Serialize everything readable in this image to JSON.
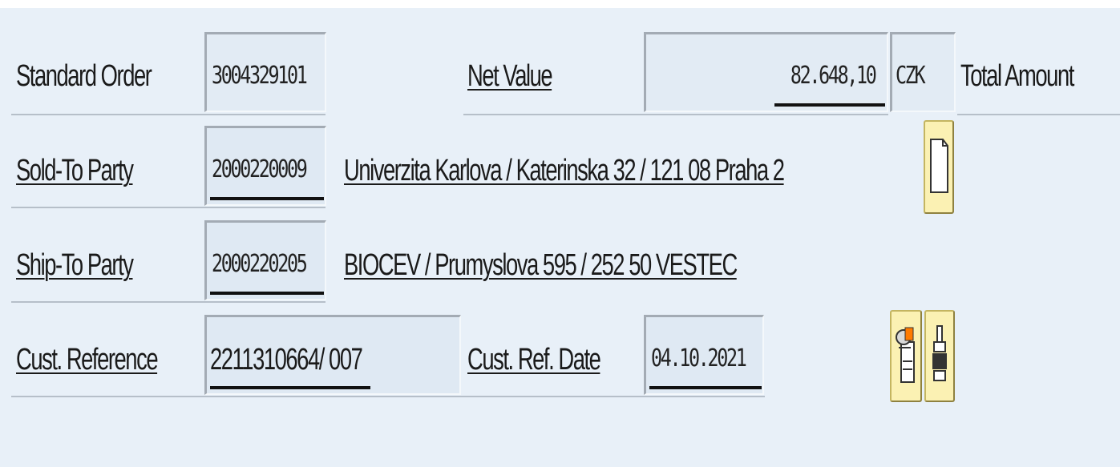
{
  "order": {
    "type_label": "Standard Order",
    "number": "3004329101",
    "net_value_label": "Net Value",
    "net_value": "82.648,10",
    "currency": "CZK",
    "total_label": "Total Amount"
  },
  "sold_to": {
    "label": "Sold-To Party",
    "number": "2000220009",
    "address": "Univerzita Karlova / Katerinska 32 / 121 08 Praha 2"
  },
  "ship_to": {
    "label": "Ship-To Party",
    "number": "2000220205",
    "address": "BIOCEV / Prumyslova 595 / 252 50 VESTEC"
  },
  "customer_ref": {
    "label": "Cust. Reference",
    "value": "2211310664/ 007",
    "date_label": "Cust. Ref. Date",
    "date": "04.10.2021"
  },
  "icons": {
    "document": "document-icon",
    "partner_search": "partner-search-icon",
    "print": "print-icon"
  }
}
